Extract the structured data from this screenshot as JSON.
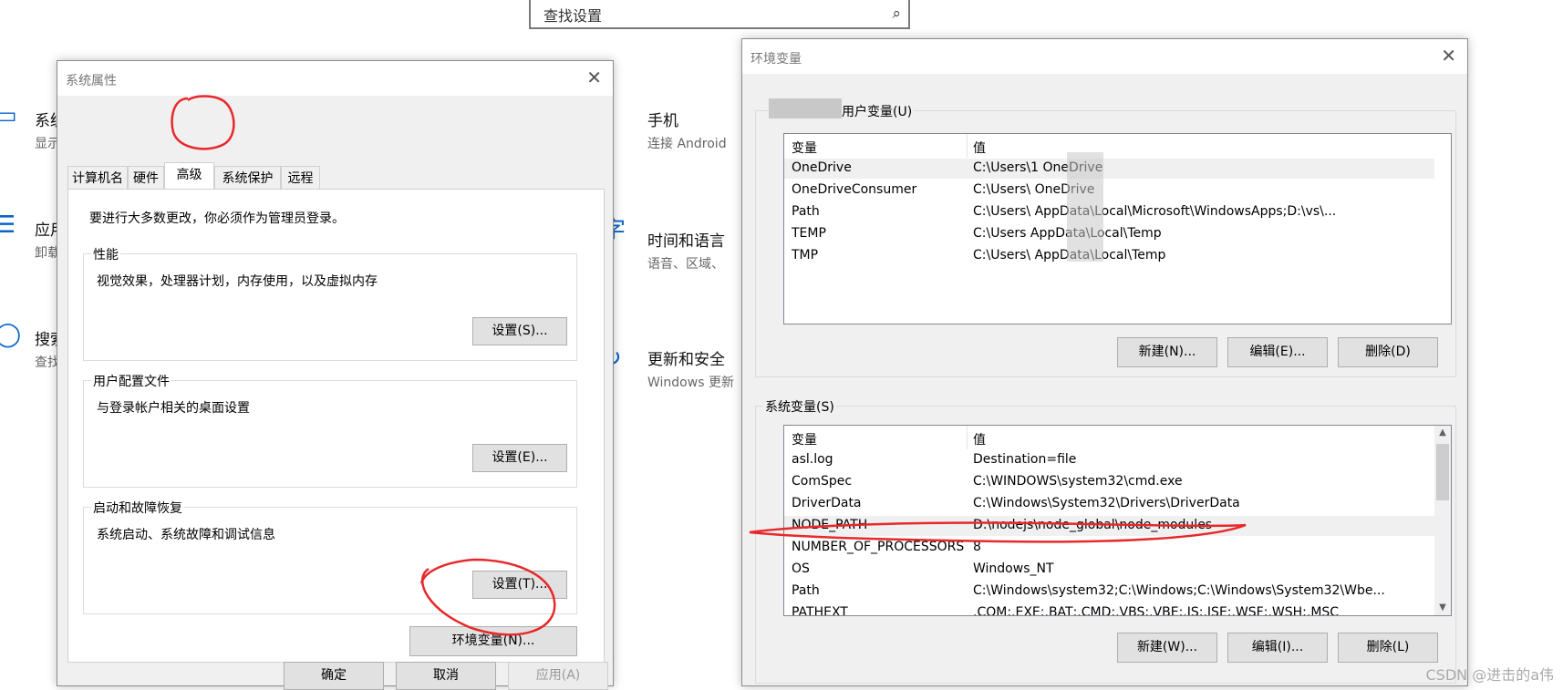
{
  "search": {
    "placeholder": "查找设置",
    "icon": "search-icon"
  },
  "background": {
    "left_items": [
      {
        "title": "系统",
        "subtitle": "显示",
        "icon": "laptop-icon"
      },
      {
        "title": "应用",
        "subtitle": "卸载",
        "icon": "list-icon"
      },
      {
        "title": "搜索",
        "subtitle": "查找",
        "icon": "search-circle-icon"
      }
    ],
    "right_items": [
      {
        "title": "手机",
        "subtitle": "连接 Android",
        "icon": "phone-icon"
      },
      {
        "title": "时间和语言",
        "subtitle": "语音、区域、",
        "icon": "language-icon"
      },
      {
        "title": "更新和安全",
        "subtitle": "Windows 更新",
        "icon": "refresh-icon"
      }
    ]
  },
  "sysprops": {
    "title": "系统属性",
    "close": "✕",
    "tabs": [
      "计算机名",
      "硬件",
      "高级",
      "系统保护",
      "远程"
    ],
    "active_tab": "高级",
    "admin_note": "要进行大多数更改，你必须作为管理员登录。",
    "groups": [
      {
        "legend": "性能",
        "desc": "视觉效果，处理器计划，内存使用，以及虚拟内存",
        "button": "设置(S)..."
      },
      {
        "legend": "用户配置文件",
        "desc": "与登录帐户相关的桌面设置",
        "button": "设置(E)..."
      },
      {
        "legend": "启动和故障恢复",
        "desc": "系统启动、系统故障和调试信息",
        "button": "设置(T)..."
      }
    ],
    "env_button": "环境变量(N)...",
    "ok": "确定",
    "cancel": "取消",
    "apply": "应用(A)"
  },
  "envvars": {
    "title": "环境变量",
    "close": "✕",
    "user_legend": "的用户变量(U)",
    "col_var": "变量",
    "col_val": "值",
    "user_rows": [
      {
        "name": "OneDrive",
        "value": "C:\\Users\\1      OneDrive"
      },
      {
        "name": "OneDriveConsumer",
        "value": "C:\\Users\\      OneDrive"
      },
      {
        "name": "Path",
        "value": "C:\\Users\\      AppData\\Local\\Microsoft\\WindowsApps;D:\\vs\\..."
      },
      {
        "name": "TEMP",
        "value": "C:\\Users       AppData\\Local\\Temp"
      },
      {
        "name": "TMP",
        "value": "C:\\Users\\      AppData\\Local\\Temp"
      }
    ],
    "user_buttons": [
      "新建(N)...",
      "编辑(E)...",
      "删除(D)"
    ],
    "sys_legend": "系统变量(S)",
    "sys_rows": [
      {
        "name": "asl.log",
        "value": "Destination=file"
      },
      {
        "name": "ComSpec",
        "value": "C:\\WINDOWS\\system32\\cmd.exe"
      },
      {
        "name": "DriverData",
        "value": "C:\\Windows\\System32\\Drivers\\DriverData"
      },
      {
        "name": "NODE_PATH",
        "value": "D:\\nodejs\\node_global\\node_modules"
      },
      {
        "name": "NUMBER_OF_PROCESSORS",
        "value": "8"
      },
      {
        "name": "OS",
        "value": "Windows_NT"
      },
      {
        "name": "Path",
        "value": "C:\\Windows\\system32;C:\\Windows;C:\\Windows\\System32\\Wbe..."
      },
      {
        "name": "PATHEXT",
        "value": ".COM;.EXE;.BAT;.CMD;.VBS;.VBE;.JS;.JSE;.WSF;.WSH;.MSC"
      }
    ],
    "sys_buttons": [
      "新建(W)...",
      "编辑(I)...",
      "删除(L)"
    ]
  },
  "watermark": "CSDN @进击的a伟",
  "colors": {
    "annotation": "#e8282b",
    "accent": "#0a64c8"
  }
}
